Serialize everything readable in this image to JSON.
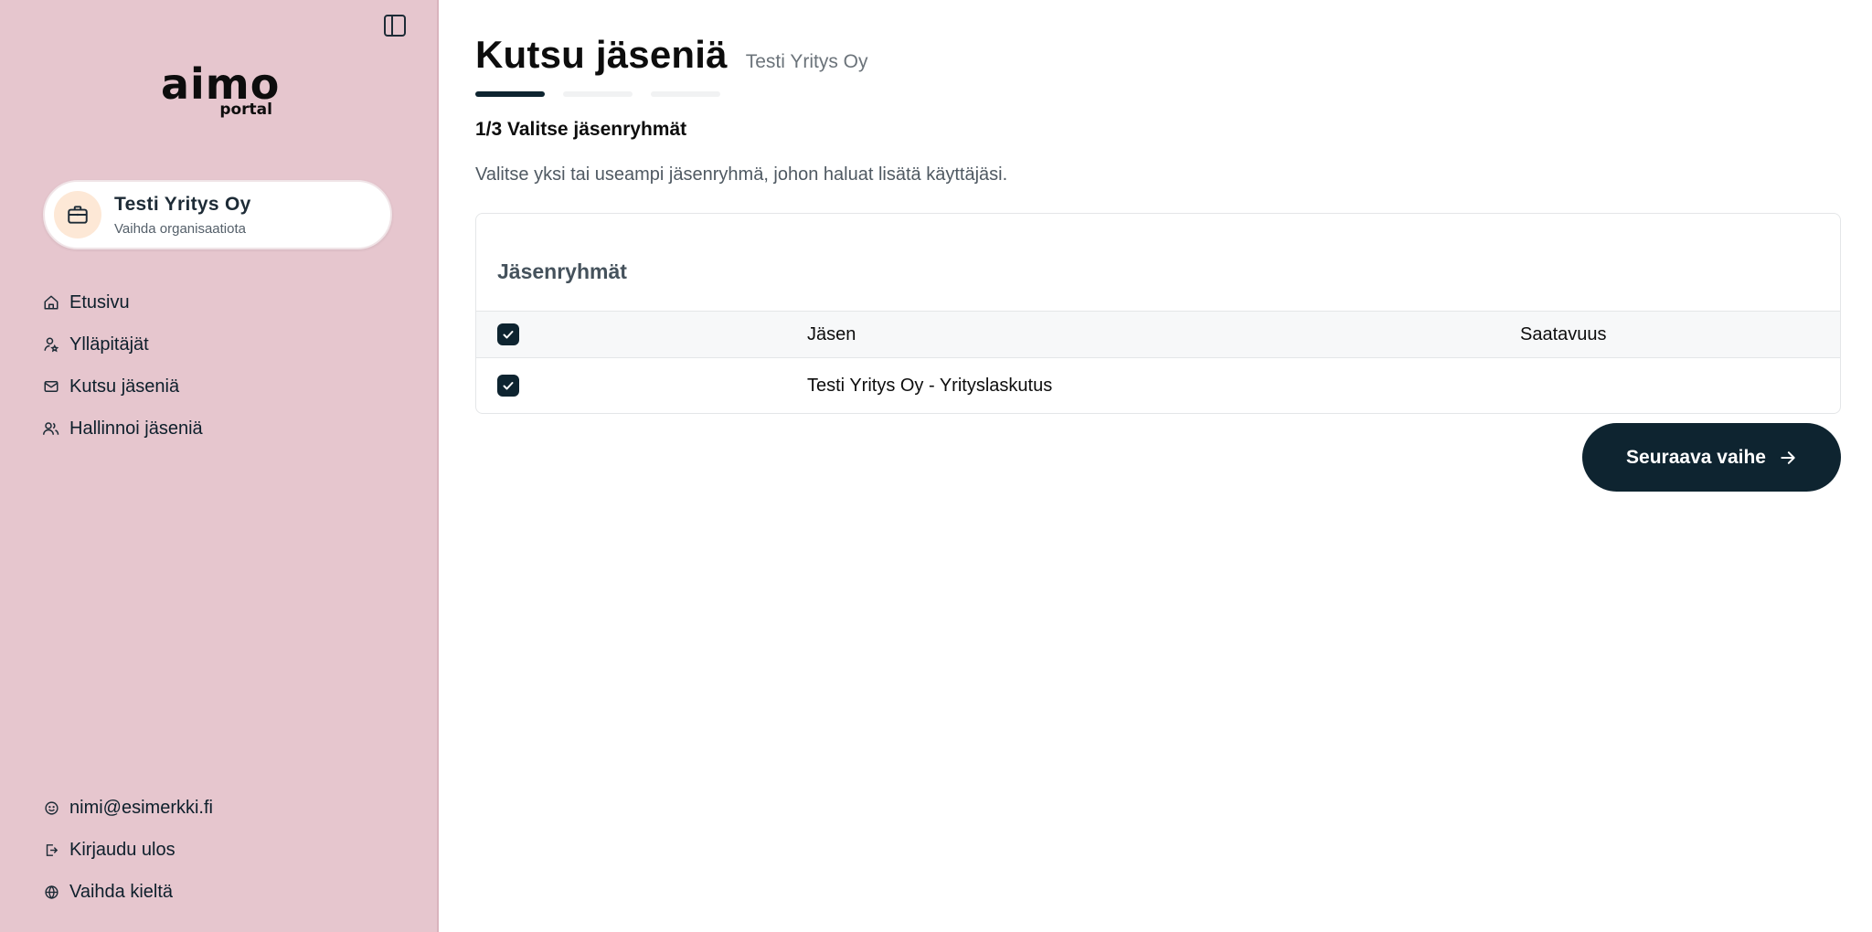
{
  "sidebar": {
    "logo_brand": "aimo",
    "logo_sub": "portal",
    "organization": {
      "name": "Testi Yritys Oy",
      "action": "Vaihda organisaatiota",
      "icon": "briefcase-icon"
    },
    "nav_items": [
      {
        "label": "Etusivu",
        "icon": "home-icon"
      },
      {
        "label": "Ylläpitäjät",
        "icon": "admin-user-icon"
      },
      {
        "label": "Kutsu jäseniä",
        "icon": "mail-icon"
      },
      {
        "label": "Hallinnoi jäseniä",
        "icon": "users-icon"
      }
    ],
    "bottom_items": [
      {
        "label": "nimi@esimerkki.fi",
        "icon": "smiley-icon"
      },
      {
        "label": "Kirjaudu ulos",
        "icon": "logout-icon"
      },
      {
        "label": "Vaihda kieltä",
        "icon": "globe-icon"
      }
    ]
  },
  "main": {
    "title": "Kutsu jäseniä",
    "subtitle": "Testi Yritys Oy",
    "steps_active": 1,
    "steps_total": 3,
    "step_heading": "1/3 Valitse jäsenryhmät",
    "step_description": "Valitse yksi tai useampi jäsenryhmä, johon haluat lisätä käyttäjäsi.",
    "groups_card": {
      "title": "Jäsenryhmät",
      "columns": [
        "Jäsen",
        "Saatavuus"
      ],
      "rows": [
        {
          "member": "Testi Yritys Oy - Yrityslaskutus",
          "availability": "",
          "checked": true
        }
      ],
      "all_checked": true
    },
    "next_button": "Seuraava vaihe"
  },
  "colors": {
    "sidebar_bg": "#e6c6ce",
    "primary_dark": "#0e2430",
    "org_icon_bg": "#fde8d6"
  }
}
